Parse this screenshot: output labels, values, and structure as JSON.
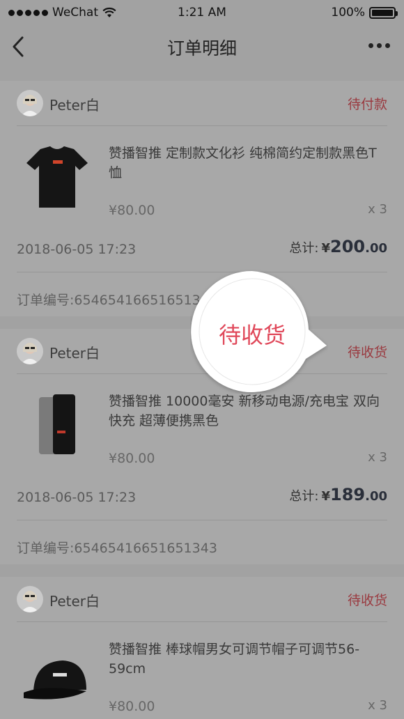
{
  "status_bar": {
    "carrier": "WeChat",
    "time": "1:21 AM",
    "battery": "100%"
  },
  "nav": {
    "title": "订单明细",
    "back_icon": "chevron-left-icon",
    "more_icon": "more-dots-icon"
  },
  "orders": [
    {
      "user": "Peter白",
      "status": "待付款",
      "product": "赞播智推   定制款文化衫   纯棉简约定制款黑色T恤",
      "price": "¥80.00",
      "qty": "x 3",
      "date": "2018-06-05 17:23",
      "total_label": "总计:",
      "total_yen": "¥",
      "total_int": "200",
      "total_dec": ".00",
      "order_no": "订单编号:65465416651651343",
      "image": "black-t-shirt"
    },
    {
      "user": "Peter白",
      "status": "待收货",
      "product": "赞播智推  10000毫安  新移动电源/充电宝 双向快充 超薄便携黑色",
      "price": "¥80.00",
      "qty": "x 3",
      "date": "2018-06-05 17:23",
      "total_label": "总计:",
      "total_yen": "¥",
      "total_int": "189",
      "total_dec": ".00",
      "order_no": "订单编号:65465416651651343",
      "image": "power-bank"
    },
    {
      "user": "Peter白",
      "status": "待收货",
      "product": "赞播智推   棒球帽男女可调节帽子可调节56-59cm",
      "price": "¥80.00",
      "qty": "x 3",
      "image": "black-cap"
    }
  ],
  "callout": {
    "text": "待收货",
    "color": "#e0485a"
  }
}
